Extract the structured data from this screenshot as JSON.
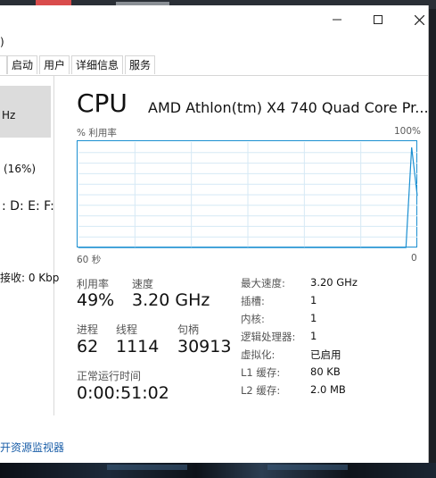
{
  "window": {
    "menu_fragment": ")",
    "controls": {
      "minimize_icon": "minimize-icon",
      "maximize_icon": "maximize-icon",
      "close_icon": "close-icon"
    }
  },
  "tabs": [
    {
      "label": "启动"
    },
    {
      "label": "用户"
    },
    {
      "label": "详细信息"
    },
    {
      "label": "服务"
    }
  ],
  "sidebar": {
    "cpu_speed_fragment": "Hz",
    "memory_fragment": "(16%)",
    "disk_fragment": ": D: E: F:",
    "network_fragment": "接收: 0 Kbp"
  },
  "cpu": {
    "title": "CPU",
    "name": "AMD Athlon(tm) X4 740 Quad Core Pr...",
    "graph": {
      "ylabel": "% 利用率",
      "ymax_label": "100%",
      "xstart_label": "60 秒",
      "xend_label": "0"
    },
    "utilization": {
      "label": "利用率",
      "value": "49%"
    },
    "speed": {
      "label": "速度",
      "value": "3.20 GHz"
    },
    "processes": {
      "label": "进程",
      "value": "62"
    },
    "threads": {
      "label": "线程",
      "value": "1114"
    },
    "handles": {
      "label": "句柄",
      "value": "30913"
    },
    "uptime": {
      "label": "正常运行时间",
      "value": "0:00:51:02"
    },
    "specs": [
      {
        "label": "最大速度:",
        "value": "3.20 GHz"
      },
      {
        "label": "插槽:",
        "value": "1"
      },
      {
        "label": "内核:",
        "value": "1"
      },
      {
        "label": "逻辑处理器:",
        "value": "1"
      },
      {
        "label": "虚拟化:",
        "value": "已启用"
      },
      {
        "label": "L1 缓存:",
        "value": "80 KB"
      },
      {
        "label": "L2 缓存:",
        "value": "2.0 MB"
      }
    ]
  },
  "footer": {
    "resource_monitor_link": "开资源监视器"
  },
  "colors": {
    "graph_line": "#1b8fd1",
    "grid": "#d6e9f5",
    "link": "#1a5ea8"
  },
  "chart_data": {
    "type": "line",
    "x": [
      0,
      1,
      2,
      3,
      4,
      5,
      6,
      7,
      8,
      9,
      10,
      11,
      12,
      13,
      14,
      15,
      16,
      17,
      18,
      19,
      20,
      21,
      22,
      23,
      24,
      25,
      26,
      27,
      28,
      29,
      30,
      31,
      32,
      33,
      34,
      35,
      36,
      37,
      38,
      39,
      40,
      41,
      42,
      43,
      44,
      45,
      46,
      47,
      48,
      49,
      50,
      51,
      52,
      53,
      54,
      55,
      56,
      57,
      58,
      59,
      60
    ],
    "values": [
      0,
      0,
      0,
      0,
      0,
      0,
      0,
      0,
      0,
      0,
      0,
      0,
      0,
      0,
      0,
      0,
      0,
      0,
      0,
      0,
      0,
      0,
      0,
      0,
      0,
      0,
      0,
      0,
      0,
      0,
      0,
      0,
      0,
      0,
      0,
      0,
      0,
      0,
      0,
      0,
      0,
      0,
      0,
      0,
      0,
      0,
      0,
      0,
      0,
      0,
      0,
      0,
      0,
      0,
      0,
      0,
      0,
      0,
      0,
      95,
      49
    ],
    "ylim": [
      0,
      100
    ],
    "xlim": [
      0,
      60
    ],
    "grid": true
  }
}
